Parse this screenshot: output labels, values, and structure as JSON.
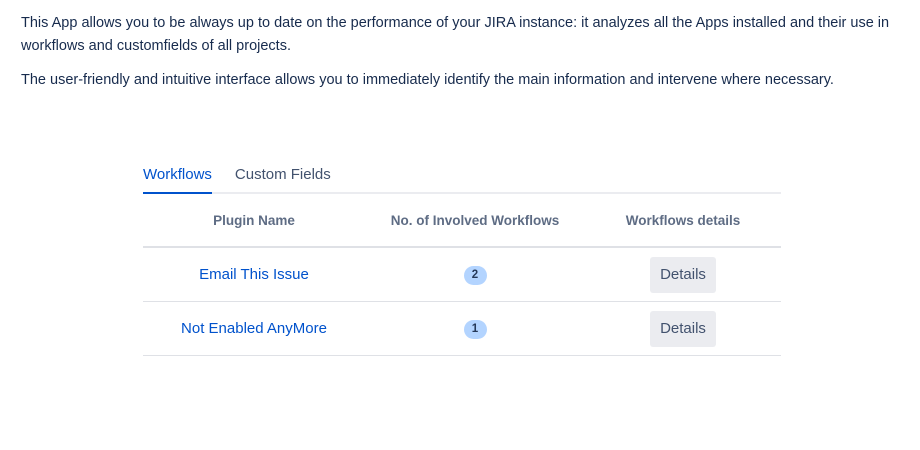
{
  "intro": {
    "paragraph1": "This App allows you to be always up to date on the performance of your JIRA instance: it analyzes all the Apps installed and their use in workflows and customfields of all projects.",
    "paragraph2": "The user-friendly and intuitive interface allows you to immediately identify the main information and intervene where necessary."
  },
  "tabs": [
    {
      "label": "Workflows",
      "active": true
    },
    {
      "label": "Custom Fields",
      "active": false
    }
  ],
  "table": {
    "headers": [
      "Plugin Name",
      "No. of Involved Workflows",
      "Workflows details"
    ],
    "rows": [
      {
        "plugin": "Email This Issue",
        "count": "2",
        "action": "Details"
      },
      {
        "plugin": "Not Enabled AnyMore",
        "count": "1",
        "action": "Details"
      }
    ]
  },
  "colors": {
    "link": "#0052cc",
    "text": "#172b4d",
    "header_text": "#5e6c84",
    "badge_bg": "#b3d4ff",
    "button_bg": "#ebecf0",
    "divider": "#dfe1e6"
  }
}
